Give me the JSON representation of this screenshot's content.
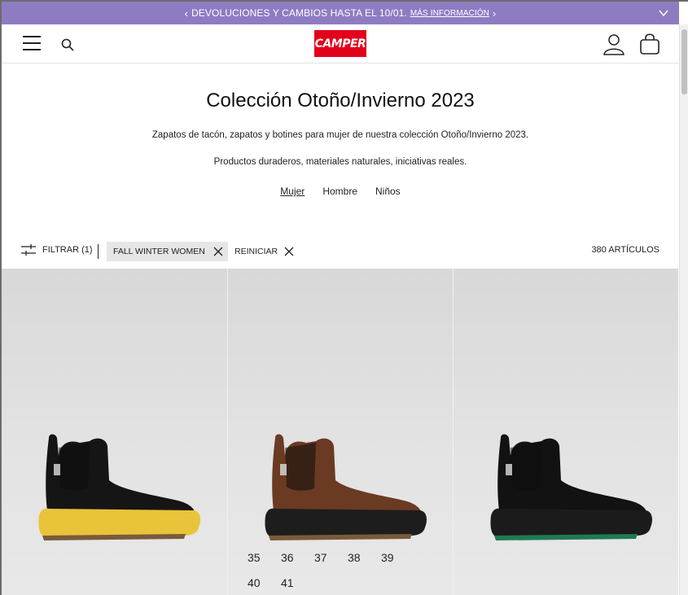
{
  "promo": {
    "text": "DEVOLUCIONES Y CAMBIOS HASTA EL 10/01.",
    "link": "MÁS INFORMACIÓN"
  },
  "header": {
    "logo_text": "CAMPER"
  },
  "main": {
    "title": "Colección Otoño/Invierno 2023",
    "description": "Zapatos de tacón, zapatos y botines para mujer de nuestra colección Otoño/Invierno 2023.",
    "tagline": "Productos duraderos, materiales naturales, iniciativas reales.",
    "genders": [
      "Mujer",
      "Hombre",
      "Niños"
    ]
  },
  "filters": {
    "filter_label": "FILTRAR (1)",
    "active_chip": "FALL WINTER WOMEN",
    "reset_label": "REINICIAR",
    "count": "380 ARTÍCULOS"
  },
  "products": [
    {
      "upper": "#151515",
      "sole": "#e9c33a",
      "tread": "#7a5a3a"
    },
    {
      "upper": "#6b3a22",
      "sole": "#1d1d1d",
      "tread": "#7a5a3a",
      "sizes": [
        "35",
        "36",
        "37",
        "38",
        "39",
        "40",
        "41"
      ]
    },
    {
      "upper": "#121212",
      "sole": "#1b1b1b",
      "tread": "#1f7a52"
    }
  ],
  "colors": {
    "promo_bg": "#8e7cc3",
    "brand": "#e3001b"
  }
}
